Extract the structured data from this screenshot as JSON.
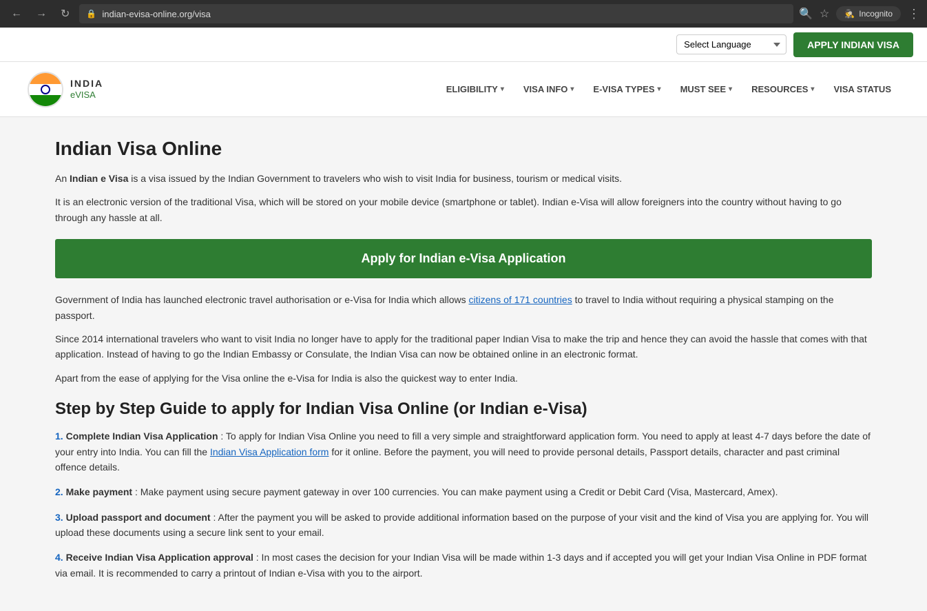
{
  "browser": {
    "back_label": "←",
    "forward_label": "→",
    "reload_label": "↻",
    "url": "indian-evisa-online.org/visa",
    "search_icon": "🔍",
    "star_icon": "☆",
    "incognito_label": "Incognito",
    "menu_icon": "⋮"
  },
  "utility_bar": {
    "language_placeholder": "Select Language",
    "apply_btn_label": "APPLY INDIAN VISA"
  },
  "navbar": {
    "logo_india": "INDIA",
    "logo_evisa": "eVISA",
    "nav_items": [
      {
        "label": "ELIGIBILITY",
        "has_arrow": true
      },
      {
        "label": "VISA INFO",
        "has_arrow": true
      },
      {
        "label": "E-VISA TYPES",
        "has_arrow": true
      },
      {
        "label": "MUST SEE",
        "has_arrow": true
      },
      {
        "label": "RESOURCES",
        "has_arrow": true
      },
      {
        "label": "VISA STATUS",
        "has_arrow": false
      }
    ]
  },
  "main": {
    "page_title": "Indian Visa Online",
    "intro_para1_text": " is a visa issued by the Indian Government to travelers who wish to visit India for business, tourism or medical visits.",
    "intro_para1_bold1": "An",
    "intro_para1_bold2": "Indian e Visa",
    "intro_para2": "It is an electronic version of the traditional Visa, which will be stored on your mobile device (smartphone or tablet). Indian e-Visa will allow foreigners into the country without having to go through any hassle at all.",
    "apply_banner_label": "Apply for Indian e-Visa Application",
    "body_para1_pre": "Government of India has launched electronic travel authorisation or e-Visa for India which allows ",
    "body_para1_link": "citizens of 171 countries",
    "body_para1_post": " to travel to India without requiring a physical stamping on the passport.",
    "body_para2": "Since 2014 international travelers who want to visit India no longer have to apply for the traditional paper Indian Visa to make the trip and hence they can avoid the hassle that comes with that application. Instead of having to go the Indian Embassy or Consulate, the Indian Visa can now be obtained online in an electronic format.",
    "body_para3": "Apart from the ease of applying for the Visa online the e-Visa for India is also the quickest way to enter India.",
    "section_title": "Step by Step Guide to apply for Indian Visa Online (or Indian e-Visa)",
    "steps": [
      {
        "num": "1.",
        "bold": "Complete Indian Visa Application",
        "pre": ": To apply for Indian Visa Online you need to fill a very simple and straightforward application form. You need to apply at least 4-7 days before the date of your entry into India. You can fill the ",
        "link": "Indian Visa Application form",
        "post": " for it online. Before the payment, you will need to provide personal details, Passport details, character and past criminal offence details."
      },
      {
        "num": "2.",
        "bold": "Make payment",
        "pre": ": Make payment using secure payment gateway in over 100 currencies. You can make payment using a Credit or Debit Card (Visa, Mastercard, Amex).",
        "link": "",
        "post": ""
      },
      {
        "num": "3.",
        "bold": "Upload passport and document",
        "pre": ": After the payment you will be asked to provide additional information based on the purpose of your visit and the kind of Visa you are applying for. You will upload these documents using a secure link sent to your email.",
        "link": "",
        "post": ""
      },
      {
        "num": "4.",
        "bold": "Receive Indian Visa Application approval",
        "pre": ": In most cases the decision for your Indian Visa will be made within 1-3 days and if accepted you will get your Indian Visa Online in PDF format via email. It is recommended to carry a printout of Indian e-Visa with you to the airport.",
        "link": "",
        "post": ""
      }
    ]
  }
}
